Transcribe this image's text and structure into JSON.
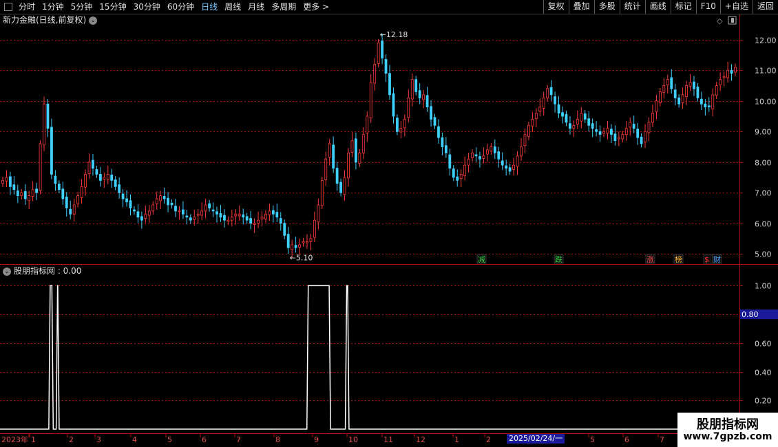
{
  "toolbar": {
    "periods": [
      "分时",
      "1分钟",
      "5分钟",
      "15分钟",
      "30分钟",
      "60分钟",
      "日线",
      "周线",
      "月线",
      "多周期",
      "更多 >"
    ],
    "active": "日线",
    "right": [
      "复权",
      "叠加",
      "多股",
      "统计",
      "画线",
      "F10",
      "+自选",
      "返回"
    ],
    "extra": "标记"
  },
  "main_chart": {
    "title": "新力金融(日线,前复权)",
    "high_label": "12.18",
    "low_label": "5.10",
    "event_markers": [
      "减",
      "跌",
      "涨",
      "榜",
      "$",
      "财"
    ],
    "colors": {
      "up": "#ff3b3b",
      "down": "#3fd0ff",
      "axis": "#b01010"
    }
  },
  "indicator": {
    "title": "股朋指标网 : 0.00",
    "current_value_label": "0.80"
  },
  "time_axis": {
    "labels": [
      "2023年",
      "1",
      "2",
      "3",
      "4",
      "5",
      "6",
      "7",
      "8",
      "9",
      "10",
      "11",
      "12",
      "1",
      "2",
      "2025/02/24/一",
      "5",
      "6",
      "7"
    ]
  },
  "watermark": {
    "line1": "股朋指标网",
    "line2": "www.7gpzb.com"
  },
  "chart_data": [
    {
      "type": "candlestick",
      "title": "新力金融(日线,前复权)",
      "ylim": [
        4.8,
        12.4
      ],
      "y_ticks": [
        "12.00",
        "11.00",
        "10.00",
        "9.00",
        "8.00",
        "7.00",
        "6.00",
        "5.00"
      ],
      "y_tick_values": [
        12,
        11,
        10,
        9,
        8,
        7,
        6,
        5
      ],
      "annotations": [
        {
          "label": "12.18",
          "value": 12.18
        },
        {
          "label": "5.10",
          "value": 5.1
        }
      ],
      "close": [
        7.4,
        7.5,
        7.2,
        7.1,
        6.9,
        7.0,
        6.8,
        6.9,
        7.1,
        7.0,
        8.6,
        9.9,
        9.1,
        7.6,
        7.3,
        7.1,
        6.8,
        6.5,
        6.3,
        6.6,
        6.9,
        7.2,
        7.6,
        8.0,
        7.8,
        7.6,
        7.4,
        7.5,
        7.6,
        7.4,
        7.2,
        7.0,
        6.8,
        6.7,
        6.5,
        6.4,
        6.2,
        6.1,
        6.3,
        6.4,
        6.6,
        6.8,
        6.9,
        6.8,
        6.6,
        6.6,
        6.4,
        6.4,
        6.3,
        6.2,
        6.1,
        6.2,
        6.3,
        6.4,
        6.6,
        6.5,
        6.4,
        6.3,
        6.2,
        6.1,
        6.1,
        6.2,
        6.3,
        6.3,
        6.2,
        6.1,
        6.0,
        6.0,
        6.1,
        6.2,
        6.3,
        6.4,
        6.3,
        6.2,
        6.0,
        5.6,
        5.2,
        5.3,
        5.2,
        5.3,
        5.4,
        5.4,
        5.5,
        6.1,
        6.6,
        7.4,
        8.1,
        8.6,
        7.8,
        7.3,
        7.0,
        7.5,
        8.3,
        8.7,
        8.0,
        8.3,
        8.9,
        9.5,
        10.6,
        11.2,
        11.9,
        11.4,
        10.9,
        10.2,
        9.5,
        9.0,
        9.1,
        9.4,
        10.1,
        10.7,
        10.3,
        10.1,
        10.2,
        9.8,
        9.4,
        9.2,
        8.8,
        8.5,
        8.3,
        7.8,
        7.5,
        7.4,
        7.6,
        7.9,
        8.1,
        8.3,
        8.2,
        8.1,
        8.2,
        8.4,
        8.5,
        8.3,
        8.1,
        7.9,
        7.8,
        7.7,
        7.9,
        8.2,
        8.5,
        8.9,
        9.2,
        9.4,
        9.6,
        9.8,
        10.1,
        10.4,
        10.2,
        9.9,
        9.6,
        9.5,
        9.3,
        9.1,
        9.2,
        9.4,
        9.6,
        9.4,
        9.2,
        9.1,
        9.0,
        8.9,
        9.0,
        9.1,
        8.9,
        8.7,
        8.8,
        8.9,
        9.1,
        9.3,
        9.1,
        8.8,
        8.6,
        9.0,
        9.3,
        9.6,
        10.0,
        10.3,
        10.5,
        10.7,
        10.4,
        10.1,
        9.9,
        10.2,
        10.5,
        10.6,
        10.4,
        10.1,
        9.9,
        9.8,
        9.8,
        10.2,
        10.5,
        10.7,
        10.8,
        11.0,
        10.9,
        11.1
      ]
    },
    {
      "type": "line",
      "title": "股朋指标网",
      "ylim": [
        0,
        1.05
      ],
      "y_ticks": [
        "1.00",
        "0.80",
        "0.60",
        "0.40",
        "0.20"
      ],
      "y_tick_values": [
        1.0,
        0.8,
        0.6,
        0.4,
        0.2
      ],
      "segments": [
        [
          0.066,
          0.072
        ],
        [
          0.076,
          0.08
        ],
        [
          0.415,
          0.447
        ],
        [
          0.467,
          0.472
        ]
      ],
      "baseline": 0.0
    }
  ]
}
